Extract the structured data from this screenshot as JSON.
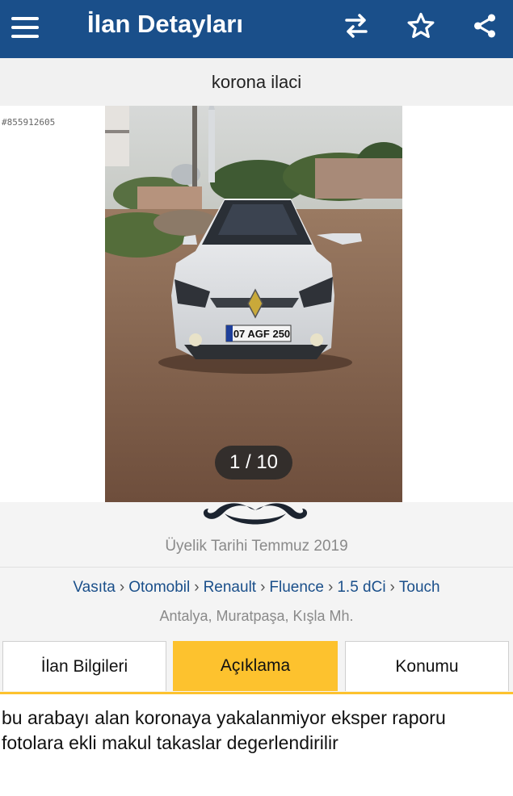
{
  "appbar": {
    "title": "İlan Detayları",
    "icons": [
      "menu-icon",
      "compare-arrows-icon",
      "star-icon",
      "share-icon"
    ],
    "background": "#1a4f8a"
  },
  "listing": {
    "heading": "korona ilaci",
    "listing_number": "#855912605",
    "photo_counter": "1 / 10"
  },
  "seller": {
    "member_since": "Üyelik Tarihi  Temmuz 2019"
  },
  "breadcrumb": {
    "items": [
      "Vasıta",
      "Otomobil",
      "Renault",
      "Fluence",
      "1.5 dCi",
      "Touch"
    ],
    "separator": "›"
  },
  "location": "Antalya, Muratpaşa, Kışla Mh.",
  "tabs": {
    "items": [
      "İlan Bilgileri",
      "Açıklama",
      "Konumu"
    ],
    "active": "Açıklama",
    "active_color": "#fdc22e"
  },
  "description": {
    "line1": "bu arabayı alan koronaya yakalanmiyor eksper raporu",
    "line2": "fotolara ekli makul takaslar degerlendirilir"
  },
  "car_photo": {
    "plate": "07 AGF 250"
  }
}
